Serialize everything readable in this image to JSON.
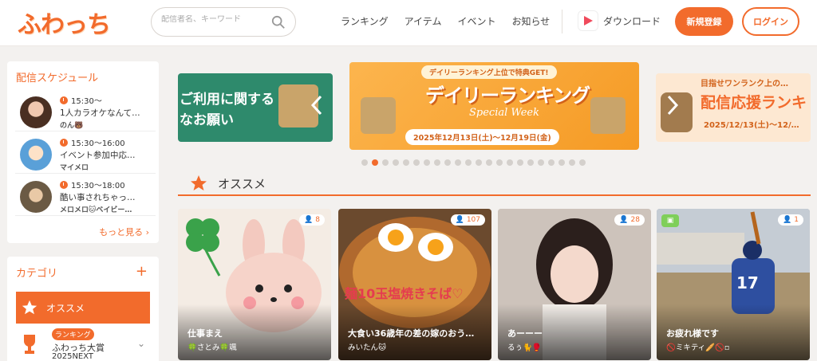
{
  "header": {
    "logo": "ふわっち",
    "search_placeholder": "配信者名、キーワード",
    "nav": [
      "ランキング",
      "アイテム",
      "イベント",
      "お知らせ"
    ],
    "download": "ダウンロード",
    "signup": "新規登録",
    "login": "ログイン"
  },
  "schedule": {
    "title": "配信スケジュール",
    "items": [
      {
        "time": "15:30〜",
        "title": "1人カラオケなんて…",
        "user": "のん🐻"
      },
      {
        "time": "15:30〜16:00",
        "title": "イベント参加中応…",
        "user": "マイメロ"
      },
      {
        "time": "15:30〜18:00",
        "title": "酷い事されちゃっ…",
        "user": "メロメロ🐱ベイビー…"
      }
    ],
    "more": "もっと見る"
  },
  "category": {
    "title": "カテゴリ",
    "active": "オススメ",
    "rank_badge": "ランキング",
    "rank_title": "ふわっち大賞",
    "rank_sub": "2025NEXT"
  },
  "banners": {
    "b1_text_1": "ご利用に関する",
    "b1_text_2": "なお願い",
    "b2_top": "デイリーランキング上位で特典GET!",
    "b2_main": "デイリーランキング",
    "b2_script": "Special Week",
    "b2_date": "2025年12月13日(土)〜12月19日(金)",
    "b3_top": "目指せワンランク上の…",
    "b3_main": "配信応援ランキ",
    "b3_date": "2025/12/13(土)〜12/…"
  },
  "carousel": {
    "dot_count": 22,
    "active_index": 1
  },
  "section": {
    "title": "オススメ"
  },
  "cards": [
    {
      "viewers": "8",
      "title": "仕事まえ",
      "user": "🍀さとみ🍀颯",
      "bg": "#f4ece4"
    },
    {
      "viewers": "107",
      "title": "大食い36歳年の差の嫁のおう…",
      "user": "みいたん🐱",
      "bg": "#6b4a2e"
    },
    {
      "viewers": "28",
      "title": "あーーー",
      "user": "るぅ🐈🥊",
      "bg": "#d8cfc8"
    },
    {
      "viewers": "1",
      "title": "お疲れ様です",
      "user": "🚫ミキティ🥖🚫▫",
      "bg": "#9fa9b4"
    }
  ],
  "colors": {
    "accent": "#f26b2c"
  }
}
